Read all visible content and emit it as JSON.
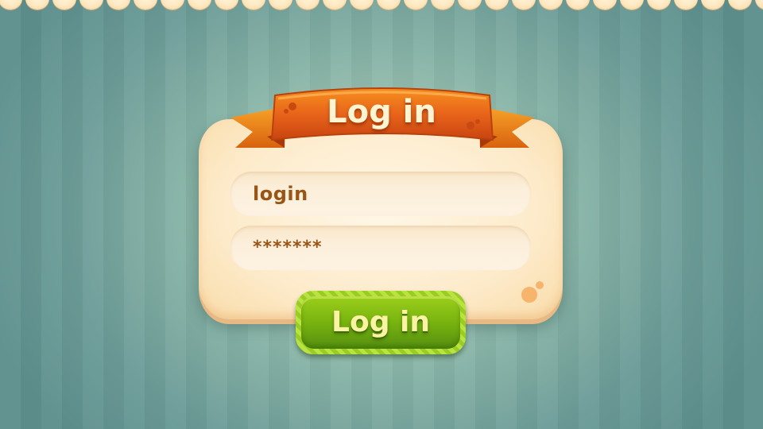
{
  "dialog": {
    "title": "Log in",
    "login_field": {
      "value": "login"
    },
    "password_field": {
      "value": "*******"
    },
    "submit_label": "Log in"
  },
  "colors": {
    "ribbon": "#e25a12",
    "card": "#fdebcb",
    "button": "#78b30f",
    "field_text": "#9a5516"
  }
}
